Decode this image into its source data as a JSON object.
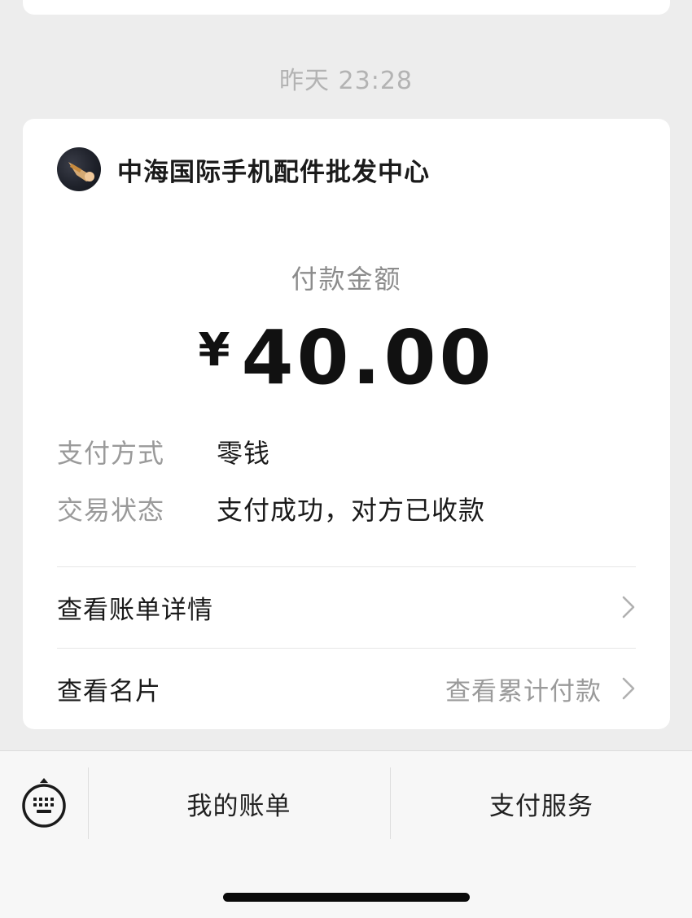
{
  "timestamp": "昨天 23:28",
  "payment_card": {
    "merchant_name": "中海国际手机配件批发中心",
    "amount_label": "付款金额",
    "currency_symbol": "¥",
    "amount": "40.00",
    "details": [
      {
        "key": "支付方式",
        "value": "零钱"
      },
      {
        "key": "交易状态",
        "value": "支付成功，对方已收款"
      }
    ],
    "links": {
      "bill_detail": {
        "label": "查看账单详情"
      },
      "business_card": {
        "label": "查看名片",
        "sub_label": "查看累计付款"
      }
    }
  },
  "bottom_menu": {
    "keyboard_icon": "keyboard-icon",
    "items": [
      "我的账单",
      "支付服务"
    ]
  },
  "colors": {
    "background": "#ededed",
    "card": "#ffffff",
    "secondary_text": "#9a9a9a"
  }
}
